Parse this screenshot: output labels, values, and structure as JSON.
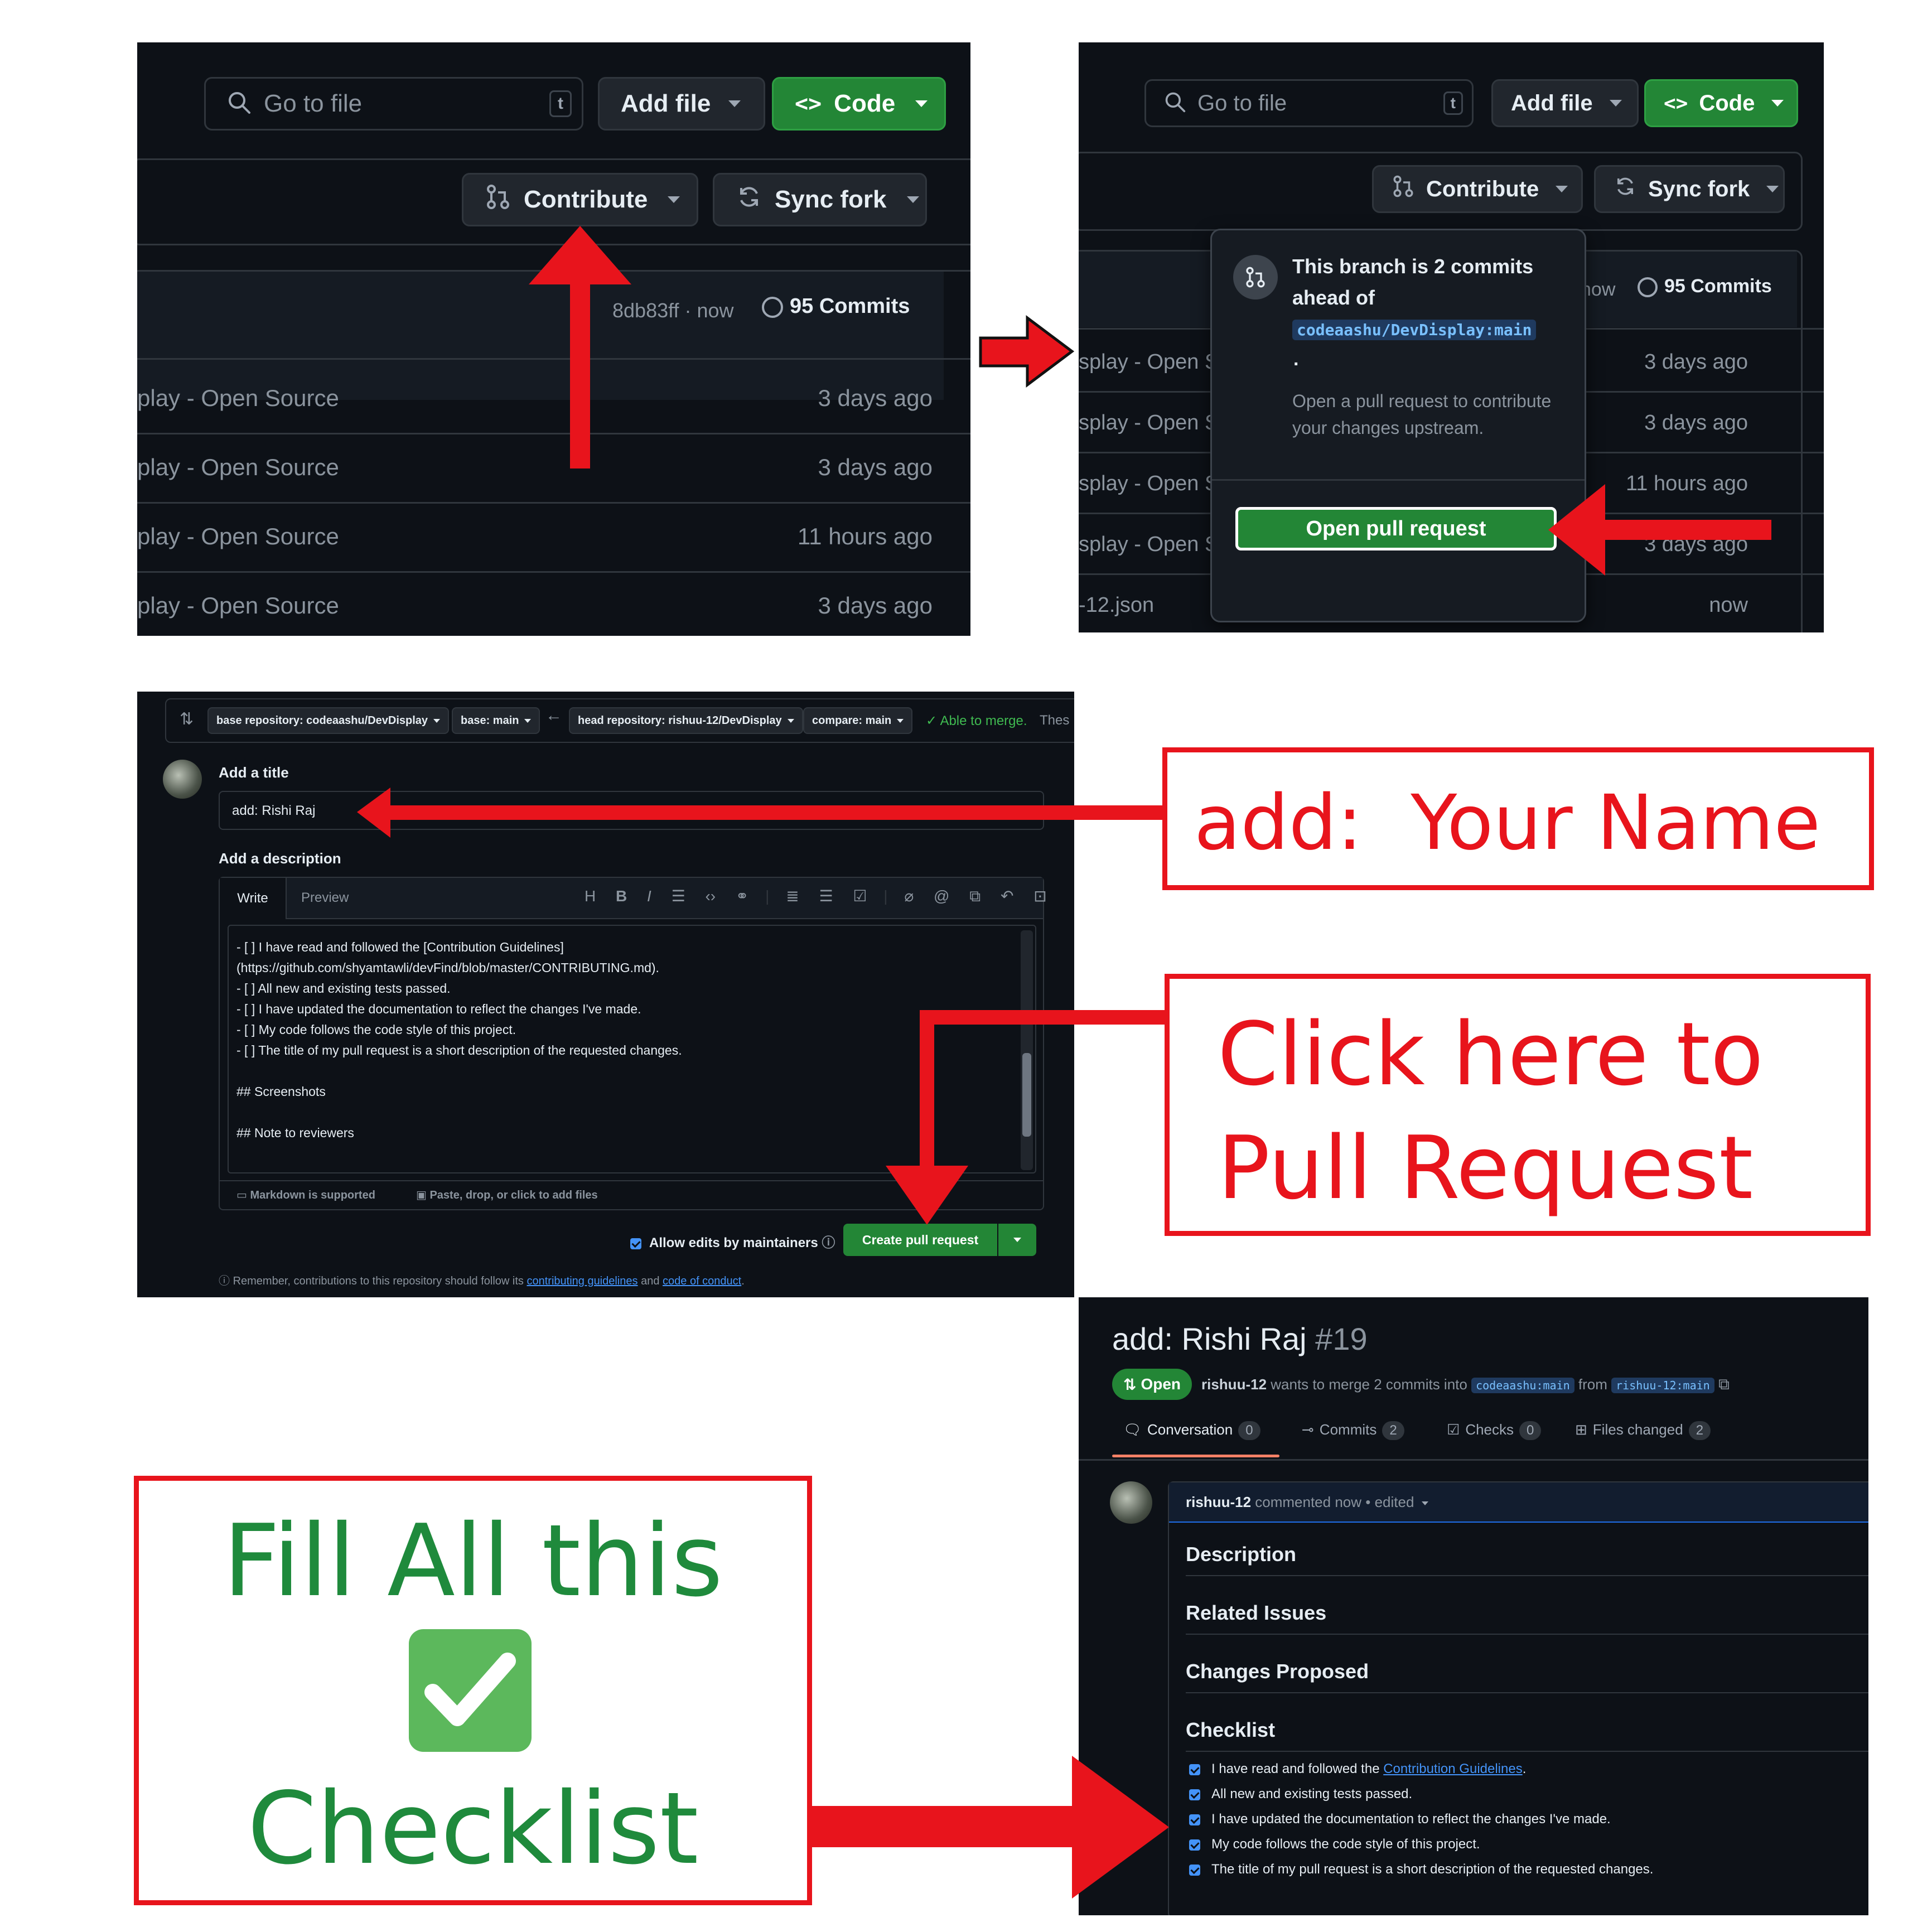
{
  "panel1": {
    "search_placeholder": "Go to file",
    "search_key": "t",
    "add_file": "Add file",
    "code": "Code",
    "contribute": "Contribute",
    "sync_fork": "Sync fork",
    "commit_hash": "8db83ff · now",
    "commits": "95 Commits",
    "rows": [
      {
        "name": "play - Open Source",
        "time": "3 days ago"
      },
      {
        "name": "play - Open Source",
        "time": "3 days ago"
      },
      {
        "name": "play - Open Source",
        "time": "11 hours ago"
      },
      {
        "name": "play - Open Source",
        "time": "3 days ago"
      }
    ]
  },
  "panel2": {
    "search_placeholder": "Go to file",
    "search_key": "t",
    "add_file": "Add file",
    "code": "Code",
    "contribute": "Contribute",
    "sync_fork": "Sync fork",
    "commits_time": "now",
    "commits": "95 Commits",
    "popover_line1": "This branch is 2 commits",
    "popover_line2": "ahead of",
    "popover_ref": "codeaashu/DevDisplay:main",
    "popover_dot": ".",
    "popover_desc1": "Open a pull request to contribute",
    "popover_desc2": "your changes upstream.",
    "open_pr": "Open pull request",
    "rows": [
      {
        "name": "splay - Open S",
        "time": "3 days ago"
      },
      {
        "name": "splay - Open S",
        "time": "3 days ago"
      },
      {
        "name": "splay - Open S",
        "time": "11 hours ago"
      },
      {
        "name": "splay - Open S",
        "time": "3 days ago"
      },
      {
        "name": "-12.json",
        "time": "now"
      }
    ]
  },
  "panel3": {
    "base_repo": "base repository: codeaashu/DevDisplay",
    "base": "base: main",
    "head_repo": "head repository: rishuu-12/DevDisplay",
    "compare": "compare: main",
    "merge_status": "✓ Able to merge.",
    "merge_more": "Thes",
    "add_title_label": "Add a title",
    "title_value": "add: Rishi Raj",
    "add_desc_label": "Add a description",
    "tab_write": "Write",
    "tab_preview": "Preview",
    "desc_lines": [
      "- [ ] I have read and followed the [Contribution Guidelines]",
      "(https://github.com/shyamtawli/devFind/blob/master/CONTRIBUTING.md).",
      "- [ ] All new and existing tests passed.",
      "- [ ] I have updated the documentation to reflect the changes I've made.",
      "- [ ] My code follows the code style of this project.",
      "- [ ] The title of my pull request is a short description of the requested changes.",
      "",
      "## Screenshots",
      "",
      "## Note to reviewers"
    ],
    "markdown_note": "Markdown is supported",
    "attach_note": "Paste, drop, or click to add files",
    "allow_edits": "Allow edits by maintainers",
    "create_pr": "Create pull request",
    "footer_pre": "Remember, contributions to this repository should follow its",
    "footer_link1": "contributing guidelines",
    "footer_and": "and",
    "footer_link2": "code of conduct",
    "footer_end": "."
  },
  "panel4": {
    "pr_title": "add: Rishi Raj",
    "pr_number": "#19",
    "state": "Open",
    "author": "rishuu-12",
    "merge_text": "wants to merge 2 commits into",
    "base_ref": "codeaashu:main",
    "from_text": "from",
    "head_ref": "rishuu-12:main",
    "tabs": [
      {
        "label": "Conversation",
        "count": "0"
      },
      {
        "label": "Commits",
        "count": "2"
      },
      {
        "label": "Checks",
        "count": "0"
      },
      {
        "label": "Files changed",
        "count": "2"
      }
    ],
    "comment_author": "rishuu-12",
    "comment_meta": "commented now • edited",
    "sections": [
      "Description",
      "Related Issues",
      "Changes Proposed",
      "Checklist"
    ],
    "checklist": [
      {
        "pre": "I have read and followed the ",
        "link": "Contribution Guidelines",
        "post": "."
      },
      {
        "pre": "All new and existing tests passed.",
        "link": "",
        "post": ""
      },
      {
        "pre": "I have updated the documentation to reflect the changes I've made.",
        "link": "",
        "post": ""
      },
      {
        "pre": "My code follows the code style of this project.",
        "link": "",
        "post": ""
      },
      {
        "pre": "The title of my pull request is a short description of the requested changes.",
        "link": "",
        "post": ""
      }
    ]
  },
  "callouts": {
    "your_name": "add:  Your Name",
    "click_line1": "Click here to",
    "click_line2": "Pull Request",
    "fill_line1": "Fill All this",
    "fill_emoji": "✅",
    "fill_line2": "Checklist"
  },
  "colors": {
    "annotation_red": "#e8141c",
    "github_green": "#238636",
    "callout_green": "#1f8a3c",
    "panel_bg": "#0d1117"
  }
}
